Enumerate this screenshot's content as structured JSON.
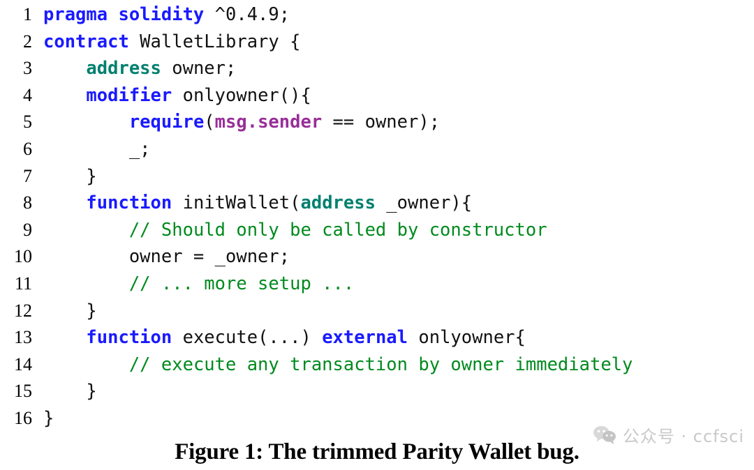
{
  "figure": {
    "caption": "Figure 1: The trimmed Parity Wallet bug.",
    "language": "solidity",
    "colors": {
      "keyword": "#1a1aff",
      "type": "#00806f",
      "builtin": "#992e99",
      "comment": "#008a1e",
      "plain": "#111111",
      "background": "#ffffff",
      "watermark_text": "#c9c9c9"
    }
  },
  "code": {
    "first_line_number": 1,
    "last_line_number": 16,
    "lines": [
      {
        "number": "1",
        "text": "pragma solidity ^0.4.9;",
        "tokens": [
          {
            "t": "pragma solidity",
            "c": "tok-kw"
          },
          {
            "t": " ^0.4.9;",
            "c": "tok-plain"
          }
        ]
      },
      {
        "number": "2",
        "text": "contract WalletLibrary {",
        "tokens": [
          {
            "t": "contract",
            "c": "tok-kw"
          },
          {
            "t": " WalletLibrary {",
            "c": "tok-plain"
          }
        ]
      },
      {
        "number": "3",
        "text": "    address owner;",
        "tokens": [
          {
            "t": "    ",
            "c": "tok-plain"
          },
          {
            "t": "address",
            "c": "tok-type"
          },
          {
            "t": " owner;",
            "c": "tok-plain"
          }
        ]
      },
      {
        "number": "4",
        "text": "    modifier onlyowner(){",
        "tokens": [
          {
            "t": "    ",
            "c": "tok-plain"
          },
          {
            "t": "modifier",
            "c": "tok-kw"
          },
          {
            "t": " onlyowner(){",
            "c": "tok-plain"
          }
        ]
      },
      {
        "number": "5",
        "text": "        require(msg.sender == owner);",
        "tokens": [
          {
            "t": "        ",
            "c": "tok-plain"
          },
          {
            "t": "require",
            "c": "tok-kw"
          },
          {
            "t": "(",
            "c": "tok-plain"
          },
          {
            "t": "msg.sender",
            "c": "tok-builtin"
          },
          {
            "t": " == owner);",
            "c": "tok-plain"
          }
        ]
      },
      {
        "number": "6",
        "text": "        _;",
        "tokens": [
          {
            "t": "        _;",
            "c": "tok-plain"
          }
        ]
      },
      {
        "number": "7",
        "text": "    }",
        "tokens": [
          {
            "t": "    }",
            "c": "tok-plain"
          }
        ]
      },
      {
        "number": "8",
        "text": "    function initWallet(address _owner){",
        "tokens": [
          {
            "t": "    ",
            "c": "tok-plain"
          },
          {
            "t": "function",
            "c": "tok-kw"
          },
          {
            "t": " initWallet(",
            "c": "tok-plain"
          },
          {
            "t": "address",
            "c": "tok-type"
          },
          {
            "t": " _owner){",
            "c": "tok-plain"
          }
        ]
      },
      {
        "number": "9",
        "text": "        // Should only be called by constructor",
        "tokens": [
          {
            "t": "        ",
            "c": "tok-plain"
          },
          {
            "t": "// Should only be called by constructor",
            "c": "tok-comment"
          }
        ]
      },
      {
        "number": "10",
        "text": "        owner = _owner;",
        "tokens": [
          {
            "t": "        owner = _owner;",
            "c": "tok-plain"
          }
        ]
      },
      {
        "number": "11",
        "text": "        // ... more setup ...",
        "tokens": [
          {
            "t": "        ",
            "c": "tok-plain"
          },
          {
            "t": "// ... more setup ...",
            "c": "tok-comment"
          }
        ]
      },
      {
        "number": "12",
        "text": "    }",
        "tokens": [
          {
            "t": "    }",
            "c": "tok-plain"
          }
        ]
      },
      {
        "number": "13",
        "text": "    function execute(...) external onlyowner{",
        "tokens": [
          {
            "t": "    ",
            "c": "tok-plain"
          },
          {
            "t": "function",
            "c": "tok-kw"
          },
          {
            "t": " execute(...) ",
            "c": "tok-plain"
          },
          {
            "t": "external",
            "c": "tok-kw"
          },
          {
            "t": " onlyowner{",
            "c": "tok-plain"
          }
        ]
      },
      {
        "number": "14",
        "text": "        // execute any transaction by owner immediately",
        "tokens": [
          {
            "t": "        ",
            "c": "tok-plain"
          },
          {
            "t": "// execute any transaction by owner immediately",
            "c": "tok-comment"
          }
        ]
      },
      {
        "number": "15",
        "text": "    }",
        "tokens": [
          {
            "t": "    }",
            "c": "tok-plain"
          }
        ]
      },
      {
        "number": "16",
        "text": "}",
        "tokens": [
          {
            "t": "}",
            "c": "tok-plain"
          }
        ]
      }
    ]
  },
  "watermark": {
    "icon": "wechat-icon",
    "text": "公众号 · ccfsci"
  }
}
